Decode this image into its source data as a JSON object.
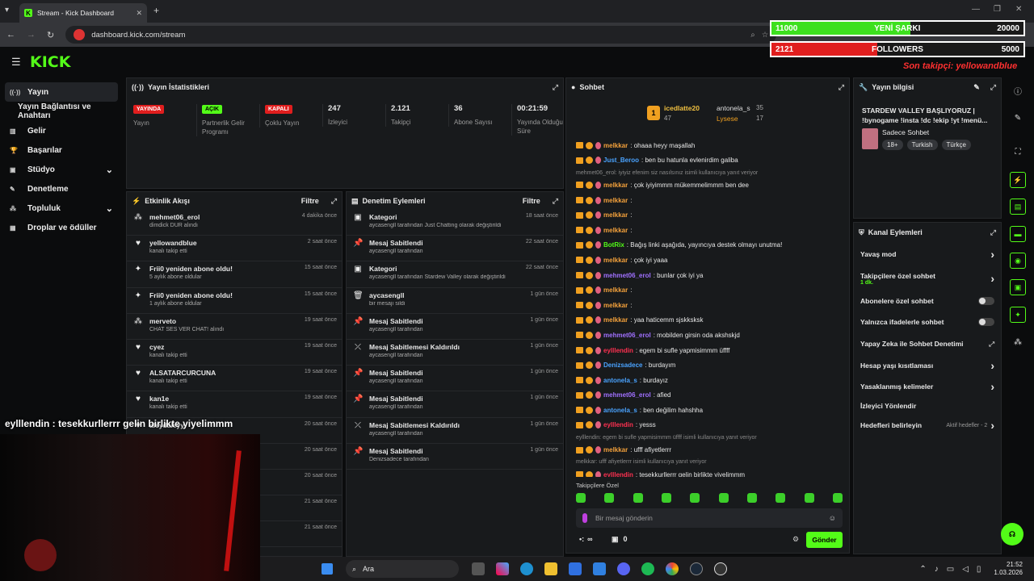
{
  "browser": {
    "tab_title": "Stream - Kick Dashboard",
    "url": "dashboard.kick.com/stream"
  },
  "brand": {
    "logo": "KICK",
    "accent": "#53fc18"
  },
  "overlay": {
    "song_left": "11000",
    "song_label": "YENİ ŞARKI",
    "song_right": "20000",
    "song_progress": 0.55,
    "followers_left": "2121",
    "followers_label": "FOLLOWERS",
    "followers_right": "5000",
    "followers_progress": 0.42,
    "last_follow": "Son takipçi: yellowandblue"
  },
  "sidebar": {
    "items": [
      {
        "label": "Yayın",
        "icon": "broadcast-icon"
      },
      {
        "label": "Yayın Bağlantısı ve Anahtarı",
        "icon": ""
      },
      {
        "label": "Gelir",
        "icon": "money-icon"
      },
      {
        "label": "Başarılar",
        "icon": "trophy-icon"
      },
      {
        "label": "Stüdyo",
        "icon": "video-icon"
      },
      {
        "label": "Denetleme",
        "icon": "wrench-icon"
      },
      {
        "label": "Topluluk",
        "icon": "users-icon"
      },
      {
        "label": "Droplar ve ödüller",
        "icon": "gift-icon"
      }
    ]
  },
  "stats": {
    "title": "Yayın İstatistikleri",
    "items": [
      {
        "badge": "YAYINDA",
        "label": "Yayın"
      },
      {
        "badge": "AÇIK",
        "label": "Partnerlik Gelir Programı"
      },
      {
        "badge": "KAPALI",
        "label": "Çoklu Yayın"
      },
      {
        "value": "247",
        "label": "İzleyici"
      },
      {
        "value": "2.121",
        "label": "Takipçi"
      },
      {
        "value": "36",
        "label": "Abone Sayısı"
      },
      {
        "value": "00:21:59",
        "label": "Yayında Olduğu Süre"
      }
    ]
  },
  "activity": {
    "title": "Etkinlik Akışı",
    "filter": "Filtre",
    "rows": [
      {
        "name": "mehmet06_erol",
        "sub": "dimdick DUR alındı",
        "time": "4 dakika önce",
        "icon": "gift-icon"
      },
      {
        "name": "yellowandblue",
        "sub": "kanalı takip etti",
        "time": "2 saat önce",
        "icon": "heart-icon"
      },
      {
        "name": "Frii0 yeniden abone oldu!",
        "sub": "5 aylık abone oldular",
        "time": "15 saat önce",
        "icon": "star-icon"
      },
      {
        "name": "Frii0 yeniden abone oldu!",
        "sub": "1 aylık abone oldular",
        "time": "15 saat önce",
        "icon": "star-icon"
      },
      {
        "name": "merveto",
        "sub": "CHAT SES VER CHAT! alındı",
        "time": "19 saat önce",
        "icon": "gift-icon"
      },
      {
        "name": "cyez",
        "sub": "kanalı takip etti",
        "time": "19 saat önce",
        "icon": "heart-icon"
      },
      {
        "name": "ALSATARCURCUNA",
        "sub": "kanalı takip etti",
        "time": "19 saat önce",
        "icon": "heart-icon"
      },
      {
        "name": "kan1e",
        "sub": "kanalı takip etti",
        "time": "19 saat önce",
        "icon": "heart-icon"
      },
      {
        "name": "aleydaleyy",
        "sub": "",
        "time": "20 saat önce",
        "icon": "heart-icon"
      },
      {
        "name": "",
        "sub": "",
        "time": "20 saat önce",
        "icon": ""
      },
      {
        "name": "",
        "sub": "",
        "time": "20 saat önce",
        "icon": ""
      },
      {
        "name": "",
        "sub": "",
        "time": "21 saat önce",
        "icon": ""
      },
      {
        "name": "",
        "sub": "",
        "time": "21 saat önce",
        "icon": ""
      }
    ]
  },
  "moderation": {
    "title": "Denetim Eylemleri",
    "filter": "Filtre",
    "rows": [
      {
        "title": "Kategori",
        "sub": "aycasengll tarafından Just Chatting olarak değiştirildi",
        "time": "18 saat önce",
        "icon": "category-icon"
      },
      {
        "title": "Mesaj Sabitlendi",
        "sub": "aycasengll tarafından",
        "time": "22 saat önce",
        "icon": "pin-icon"
      },
      {
        "title": "Kategori",
        "sub": "aycasengll tarafından Stardew Valley olarak değiştirildi",
        "time": "22 saat önce",
        "icon": "category-icon"
      },
      {
        "title": "aycasengll",
        "sub": "bir mesajı sildi",
        "time": "1 gün önce",
        "icon": "trash-icon"
      },
      {
        "title": "Mesaj Sabitlendi",
        "sub": "aycasengll tarafından",
        "time": "1 gün önce",
        "icon": "pin-icon"
      },
      {
        "title": "Mesaj Sabitlemesi Kaldırıldı",
        "sub": "aycasengll tarafından",
        "time": "1 gün önce",
        "icon": "unpin-icon"
      },
      {
        "title": "Mesaj Sabitlendi",
        "sub": "aycasengll tarafından",
        "time": "1 gün önce",
        "icon": "pin-icon"
      },
      {
        "title": "Mesaj Sabitlendi",
        "sub": "aycasengll tarafından",
        "time": "1 gün önce",
        "icon": "pin-icon"
      },
      {
        "title": "Mesaj Sabitlemesi Kaldırıldı",
        "sub": "aycasengll tarafından",
        "time": "1 gün önce",
        "icon": "unpin-icon"
      },
      {
        "title": "Mesaj Sabitlendi",
        "sub": "Denizsadece tarafından",
        "time": "1 gün önce",
        "icon": "pin-icon"
      }
    ]
  },
  "chat": {
    "title": "Sohbet",
    "top": [
      {
        "name": "icedlatte20",
        "count": "47"
      },
      {
        "name": "antonela_s",
        "count": "35"
      },
      {
        "name": "Lysese",
        "count": "17"
      }
    ],
    "messages": [
      {
        "user": "melkkar",
        "color": "#f4a13b",
        "text": ": ohaaa heyy maşallah"
      },
      {
        "user": "Just_Beroo",
        "color": "#4aa3ff",
        "text": ": ben bu hatunla evlenirdim galiba"
      },
      {
        "reply": "mehmet06_erol: iyiyiz efenim siz nasılsınız isimli kullanıcıya yanıt veriyor"
      },
      {
        "user": "melkkar",
        "color": "#f4a13b",
        "text": ": çok iyiyimmm mükemmelimmm ben dee"
      },
      {
        "user": "melkkar",
        "color": "#f4a13b",
        "text": ":"
      },
      {
        "user": "melkkar",
        "color": "#f4a13b",
        "text": ":"
      },
      {
        "user": "melkkar",
        "color": "#f4a13b",
        "text": ":"
      },
      {
        "user": "BotRix",
        "color": "#53fc18",
        "text": ": Bağış linki aşağıda, yayıncıya destek olmayı unutma!"
      },
      {
        "user": "melkkar",
        "color": "#f4a13b",
        "text": ": çok iyi yaaa"
      },
      {
        "user": "mehmet06_erol",
        "color": "#a070ff",
        "text": ": bunlar çok iyi ya"
      },
      {
        "user": "melkkar",
        "color": "#f4a13b",
        "text": ":"
      },
      {
        "user": "melkkar",
        "color": "#f4a13b",
        "text": ":"
      },
      {
        "user": "melkkar",
        "color": "#f4a13b",
        "text": ": yaa haticemm sjskksksk"
      },
      {
        "user": "mehmet06_erol",
        "color": "#a070ff",
        "text": ": mobilden girsin oda akshskjd"
      },
      {
        "user": "eylllendin",
        "color": "#ff3050",
        "text": ": egem bi sufle yapmisimmm üffff"
      },
      {
        "user": "Denizsadece",
        "color": "#4aa3ff",
        "text": ": burdayım"
      },
      {
        "user": "antonela_s",
        "color": "#4aa3ff",
        "text": ": burdayız"
      },
      {
        "user": "mehmet06_erol",
        "color": "#a070ff",
        "text": ": afied"
      },
      {
        "user": "antonela_s",
        "color": "#4aa3ff",
        "text": ": ben değilim hahshha"
      },
      {
        "user": "eylllendin",
        "color": "#ff3050",
        "text": ": yesss"
      },
      {
        "reply": "eylllendin: egem bi sufle yapmisimmm üffff isimli kullanıcıya yanıt veriyor"
      },
      {
        "user": "melkkar",
        "color": "#f4a13b",
        "text": ": ufff afiyetlerrr"
      },
      {
        "reply": "melkkar: ufff afiyetlerrr isimli kullanıcıya yanıt veriyor"
      },
      {
        "user": "eylllendin",
        "color": "#ff3050",
        "text": ": tesekkurllerrr gelin birlikte yiyelimmm"
      }
    ],
    "followers_only": "Takipçilere Özel",
    "placeholder": "Bir mesaj gönderin",
    "points": "∞",
    "gifts": "0",
    "send": "Gönder"
  },
  "info": {
    "title": "Yayın bilgisi",
    "stream_title": "STARDEW VALLEY BAŞLIYORUZ | !bynogame !insta !dc !ekip !yt !menü...",
    "category": "Sadece Sohbet",
    "tags": [
      "18+",
      "Turkish",
      "Türkçe"
    ]
  },
  "channel": {
    "title": "Kanal Eylemleri",
    "items": [
      {
        "label": "Yavaş mod",
        "type": "chevron"
      },
      {
        "label": "Takipçilere özel sohbet",
        "sub": "1 dk.",
        "type": "chevron"
      },
      {
        "label": "Abonelere özel sohbet",
        "type": "toggle"
      },
      {
        "label": "Yalnızca ifadelerle sohbet",
        "type": "toggle"
      },
      {
        "label": "Yapay Zeka ile Sohbet Denetimi",
        "type": "ext"
      },
      {
        "label": "Hesap yaşı kısıtlaması",
        "type": "chevron"
      },
      {
        "label": "Yasaklanmış kelimeler",
        "type": "chevron"
      },
      {
        "label": "İzleyici Yönlendir",
        "type": "none"
      },
      {
        "label": "Hedefleri belirleyin",
        "sub": "Aktif hedefler - 2",
        "type": "chevron"
      }
    ]
  },
  "webcam": {
    "caption": "eylllendin : tesekkurllerrr gelin birlikte yiyelimmm"
  },
  "taskbar": {
    "search": "Ara",
    "time": "21:52",
    "date": "1.03.2026"
  }
}
